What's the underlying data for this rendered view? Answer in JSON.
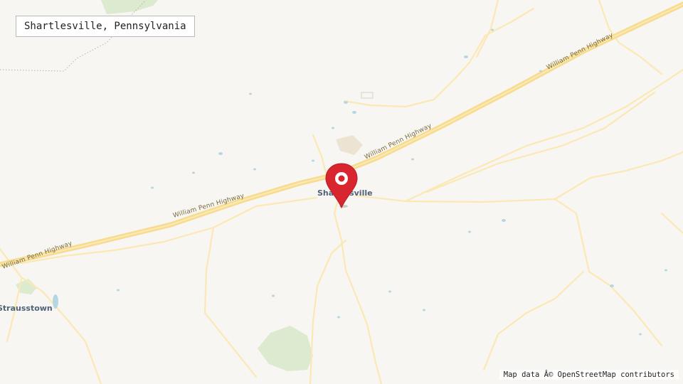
{
  "map": {
    "title": "Shartlesville, Pennsylvania",
    "attribution": "Map data Â© OpenStreetMap contributors",
    "marker": {
      "name": "location-pin-icon",
      "color": "#d9262e"
    },
    "roads": {
      "highway_label_1": "William Penn Highway",
      "highway_label_2": "William Penn Highway",
      "highway_label_3": "William Penn Highway",
      "highway_label_4": "William Penn Highway"
    },
    "places": {
      "main": "Shartlesville",
      "west": "Strausstown"
    },
    "colors": {
      "background": "#f8f6f2",
      "highway": "#f7dc8f",
      "minor_road": "#fbe8b4",
      "park": "#dcebcf",
      "water": "#b7d6e3"
    }
  }
}
